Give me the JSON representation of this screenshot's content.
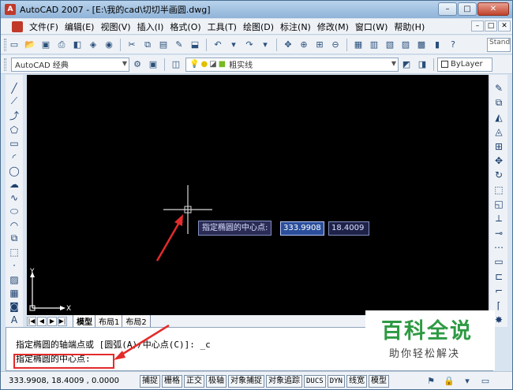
{
  "window": {
    "app_icon": "A",
    "title": "AutoCAD 2007 - [E:\\我的cad\\切切半画圆.dwg]",
    "controls": [
      "–",
      "□",
      "✕"
    ]
  },
  "menubar": {
    "items": [
      "文件(F)",
      "编辑(E)",
      "视图(V)",
      "插入(I)",
      "格式(O)",
      "工具(T)",
      "绘图(D)",
      "标注(N)",
      "修改(M)",
      "窗口(W)",
      "帮助(H)"
    ],
    "doc_controls": [
      "–",
      "□",
      "✕"
    ]
  },
  "toolbar": {
    "workspace": "AutoCAD 经典",
    "linetype": "粗实线",
    "lineweight": "ByLayer",
    "style_search": "Stand"
  },
  "layout_tabs": {
    "nav": [
      "|◀",
      "◀",
      "▶",
      "▶|"
    ],
    "tabs": [
      "模型",
      "布局1",
      "布局2"
    ]
  },
  "canvas": {
    "axis_y": "Y",
    "axis_x": "X"
  },
  "dynamic_input": {
    "prompt": "指定椭圆的中心点:",
    "x_value": "333.9908",
    "y_value": "18.4009"
  },
  "command": {
    "line1": "指定椭圆的轴端点或 [圆弧(A)/中心点(C)]: _c",
    "line2": "指定椭圆的中心点:"
  },
  "status": {
    "coords": "333.9908, 18.4009 , 0.0000",
    "buttons": [
      "捕捉",
      "栅格",
      "正交",
      "极轴",
      "对象捕捉",
      "对象追踪",
      "DUCS",
      "DYN",
      "线宽",
      "模型"
    ]
  },
  "watermark": {
    "brand": "百科全说",
    "slogan": "助你轻松解决"
  },
  "colors": {
    "annotation_red": "#e32b2b",
    "watermark_green": "#2e9a43",
    "canvas_bg": "#000000"
  }
}
